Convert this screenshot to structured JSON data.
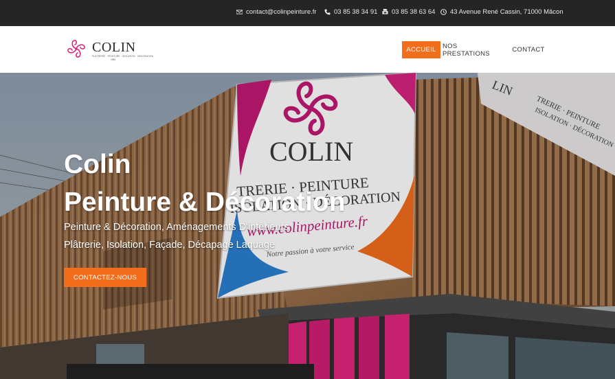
{
  "topbar": {
    "email": "contact@colinpeinture.fr",
    "phone": "03 85 38 34 91",
    "fax": "03 85 38 63 64",
    "address": "43 Avenue René Cassin, 71000 Mâcon"
  },
  "logo": {
    "name": "COLIN",
    "tagline": "PLÂTRERIE · PEINTURE · ISOLATION · DÉCORATION",
    "year": "1955"
  },
  "nav": {
    "items": [
      "ACCUEIL",
      "NOS PRESTATIONS",
      "CONTACT"
    ],
    "active": "ACCUEIL"
  },
  "hero": {
    "title_line1": "Colin",
    "title_line2": "Peinture & Décoration",
    "subtitle_line1": "Peinture & Décoration, Aménagements D'intérieurs",
    "subtitle_line2": "Plâtrerie, Isolation, Façade, Décapage Laquage",
    "cta": "CONTACTEZ-NOUS",
    "sign_brand": "COLIN",
    "sign_line1": "TRERIE · PEINTURE",
    "sign_line2": "ISOLATION · DÉCORATION",
    "sign_url": "www.colinpeinture.fr",
    "sign_motto": "Notre passion à votre service",
    "side_brand": "LIN",
    "side_line1": "TRERIE · PEINTURE",
    "side_line2": "ISOLATION · DÉCORATION"
  },
  "colors": {
    "accent": "#f26d1c",
    "brand_magenta": "#d6247f",
    "topbar_bg": "#252525"
  },
  "icons": {
    "email": "envelope-icon",
    "phone": "phone-icon",
    "fax": "fax-icon",
    "address": "clock-icon",
    "logo": "flower-logo-icon"
  }
}
